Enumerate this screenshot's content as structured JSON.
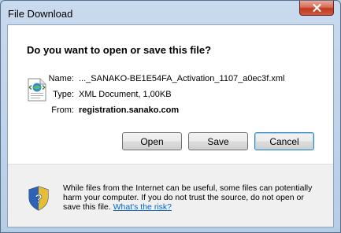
{
  "window": {
    "title": "File Download"
  },
  "dialog": {
    "heading": "Do you want to open or save this file?",
    "file": {
      "name_label": "Name:",
      "name_value": "..._SANAKO-BE1E54FA_Activation_1107_a0ec3f.xml",
      "type_label": "Type:",
      "type_value": "XML Document, 1,00KB",
      "from_label": "From:",
      "from_value": "registration.sanako.com",
      "icon": "xml-file-icon"
    },
    "buttons": {
      "open": "Open",
      "save": "Save",
      "cancel": "Cancel"
    },
    "warning": {
      "text": "While files from the Internet can be useful, some files can potentially harm your computer. If you do not trust the source, do not open or save this file. ",
      "link": "What's the risk?",
      "icon": "shield-icon"
    }
  },
  "colors": {
    "close_button": "#c7452a",
    "link": "#0066cc",
    "default_button_border": "#3c7fb1"
  }
}
